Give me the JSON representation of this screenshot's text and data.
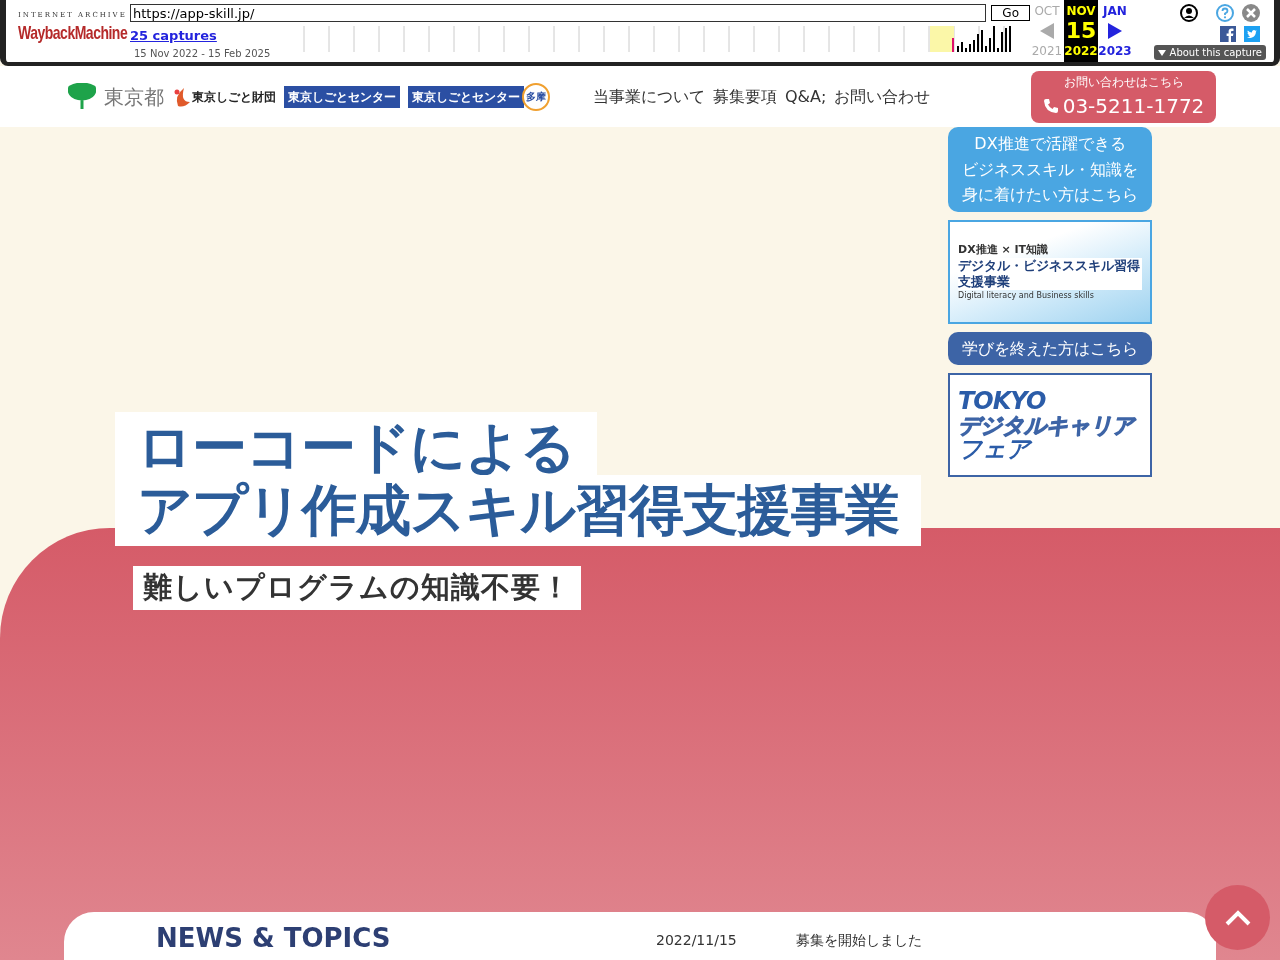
{
  "wayback": {
    "brand_top": "INTERNET ARCHIVE",
    "brand": "WaybackMachine",
    "url": "https://app-skill.jp/",
    "go": "Go",
    "captures": "25 captures",
    "range": "15 Nov 2022 - 15 Feb 2025",
    "prev": {
      "month": "OCT",
      "year": "2021"
    },
    "current": {
      "month": "NOV",
      "day": "15",
      "year": "2022"
    },
    "next": {
      "month": "JAN",
      "year": "2023"
    },
    "about": "About this capture"
  },
  "header": {
    "logos": [
      {
        "kind": "tokyo",
        "text": "東京都"
      },
      {
        "kind": "zaidan",
        "text": "東京しごと財団"
      },
      {
        "kind": "center",
        "text": "東京しごとセンター"
      },
      {
        "kind": "tama",
        "text": "東京しごとセンター",
        "badge": "多摩"
      }
    ],
    "nav": [
      "当事業について",
      "募集要項",
      "Q&A;",
      "お問い合わせ"
    ],
    "contact": {
      "caption": "お問い合わせはこちら",
      "phone": "03-5211-1772"
    }
  },
  "hero": {
    "title_lines": [
      "ローコードによる",
      "アプリ作成スキル習得支援事業"
    ],
    "subtitle": "難しいプログラムの知識不要！"
  },
  "sidebar": [
    {
      "kind": "link-button",
      "color": "#4aa6e2",
      "lines": [
        "DX推進で活躍できる",
        "ビジネススキル・知識を",
        "身に着けたい方はこちら"
      ]
    },
    {
      "kind": "dx-banner",
      "tag": "DX推進 × IT知識",
      "title": "デジタル・ビジネススキル習得支援事業",
      "caption": "Digital literacy and Business skills"
    },
    {
      "kind": "link-button",
      "color": "#3d64a6",
      "lines": [
        "学びを終えた方はこちら"
      ]
    },
    {
      "kind": "fair-banner",
      "lines": [
        "TOKYO",
        "デジタルキャリア",
        "フェア"
      ]
    }
  ],
  "news": {
    "title": "NEWS & TOPICS",
    "items": [
      {
        "date": "2022/11/15",
        "text": "募集を開始しました"
      }
    ]
  }
}
